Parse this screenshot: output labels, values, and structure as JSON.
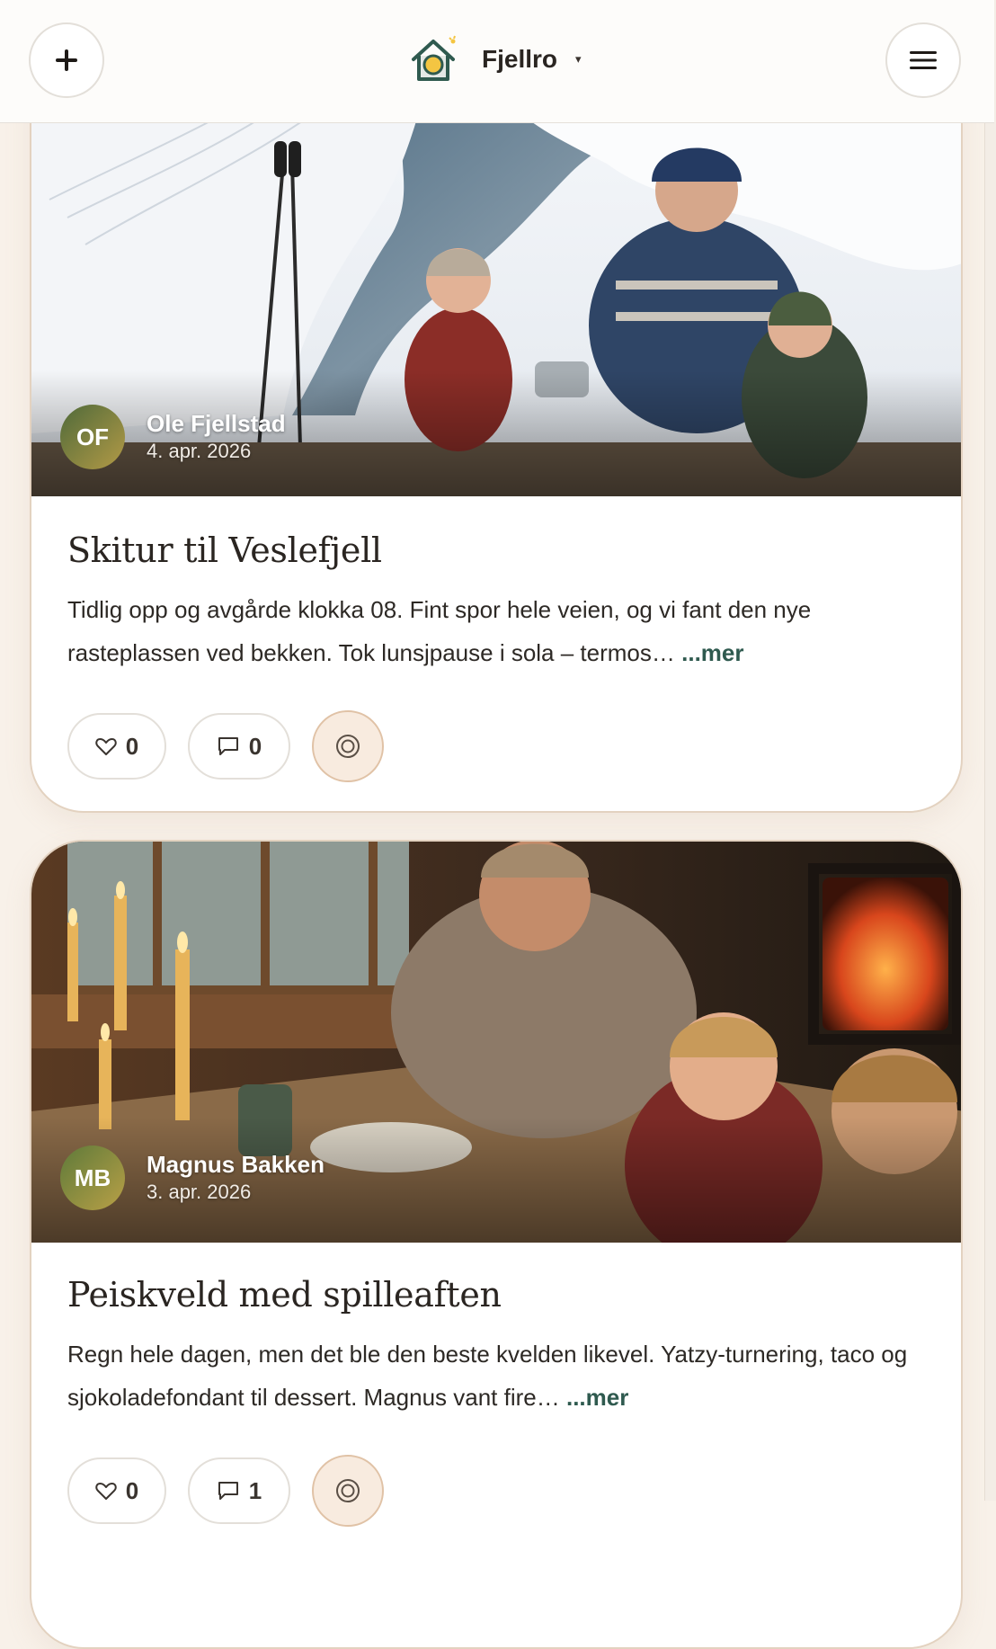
{
  "header": {
    "add_button_label": "+",
    "brand_name": "Fjellro",
    "brand_caret": "▾"
  },
  "posts": [
    {
      "author_initials": "OF",
      "author_name": "Ole Fjellstad",
      "date": "4. apr. 2026",
      "title": "Skitur til Veslefjell",
      "excerpt": "Tidlig opp og avgårde klokka 08. Fint spor hele veien, og vi fant den nye rasteplassen ved bekken. Tok lunsjpause i sola – termos…",
      "more_label": "...mer",
      "likes": "0",
      "comments": "0"
    },
    {
      "author_initials": "MB",
      "author_name": "Magnus Bakken",
      "date": "3. apr. 2026",
      "title": "Peiskveld med spilleaften",
      "excerpt": "Regn hele dagen, men det ble den beste kvelden likevel. Yatzy-turnering, taco og sjokoladefondant til dessert. Magnus vant fire…",
      "more_label": "...mer",
      "likes": "0",
      "comments": "1"
    }
  ],
  "colors": {
    "accent": "#2f5a4f",
    "background": "#f8f1e9",
    "card_border": "#e3d2c0"
  }
}
